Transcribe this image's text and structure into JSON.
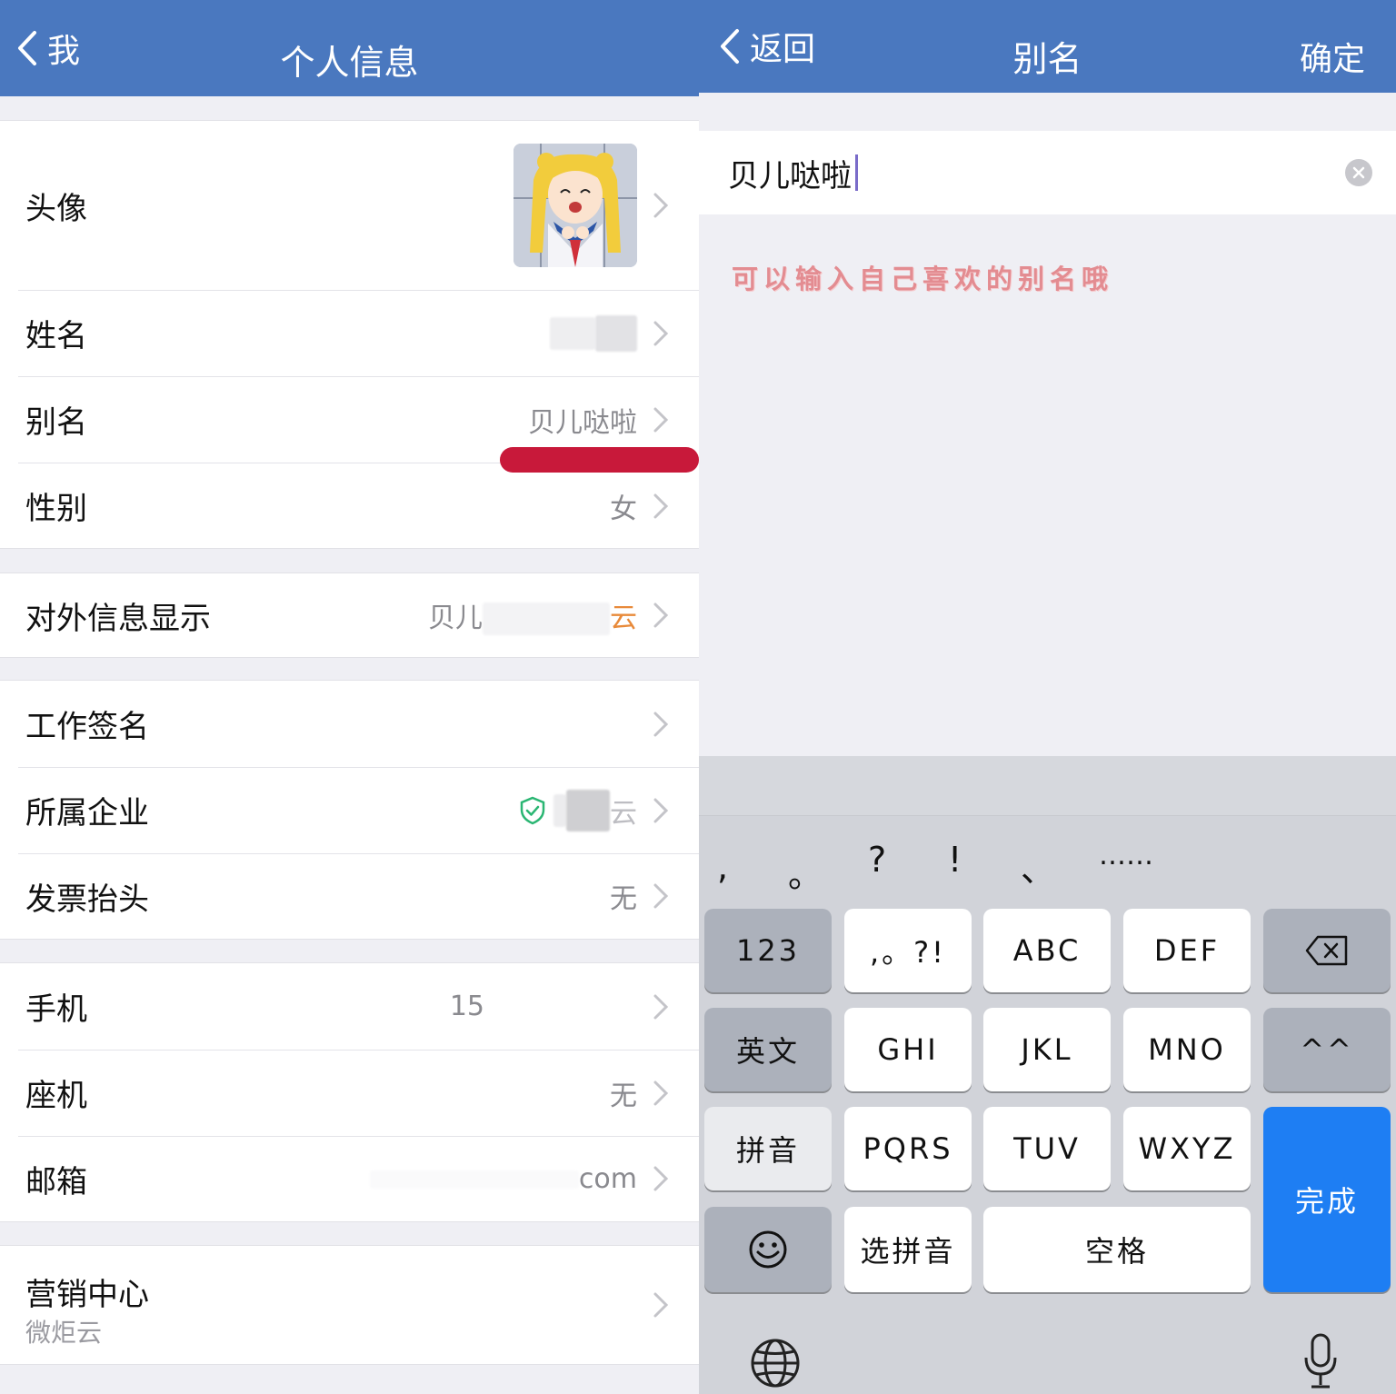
{
  "left": {
    "nav": {
      "back_label": "我",
      "title": "个人信息"
    },
    "rows": {
      "avatar": {
        "label": "头像"
      },
      "name": {
        "label": "姓名"
      },
      "alias": {
        "label": "别名",
        "value": "贝儿哒啦"
      },
      "gender": {
        "label": "性别",
        "value": "女"
      },
      "external": {
        "label": "对外信息显示",
        "value_start": "贝儿",
        "value_end": "云"
      },
      "signature": {
        "label": "工作签名"
      },
      "company": {
        "label": "所属企业",
        "value_end": "云"
      },
      "invoice": {
        "label": "发票抬头",
        "value": "无"
      },
      "mobile": {
        "label": "手机",
        "value": "15"
      },
      "landline": {
        "label": "座机",
        "value": "无"
      },
      "email": {
        "label": "邮箱",
        "value": "com"
      },
      "marketing": {
        "label": "营销中心",
        "sublabel": "微炬云"
      }
    }
  },
  "right": {
    "nav": {
      "back_label": "返回",
      "title": "别名",
      "confirm_label": "确定"
    },
    "input": {
      "value": "贝儿哒啦"
    },
    "hint": "可以输入自己喜欢的别名哦",
    "keyboard": {
      "punct": [
        ",",
        "。",
        "?",
        "!",
        "、",
        "……"
      ],
      "keys": {
        "k123": "123",
        "punct_key": ",。?!",
        "abc": "ABC",
        "def": "DEF",
        "english": "英文",
        "ghi": "GHI",
        "jkl": "JKL",
        "mno": "MNO",
        "caret": "^^",
        "pinyin": "拼音",
        "pqrs": "PQRS",
        "tuv": "TUV",
        "wxyz": "WXYZ",
        "done": "完成",
        "select_pinyin": "选拼音",
        "space": "空格"
      }
    }
  },
  "colors": {
    "nav_bar": "#4a78bf",
    "done_key": "#1e7ef3",
    "underline": "#c8193a",
    "hint": "#e38c91"
  },
  "icons": [
    "chevron-left-icon",
    "chevron-right-icon",
    "verified-shield-icon",
    "clear-icon",
    "backspace-icon",
    "emoji-icon",
    "globe-icon",
    "microphone-icon"
  ]
}
